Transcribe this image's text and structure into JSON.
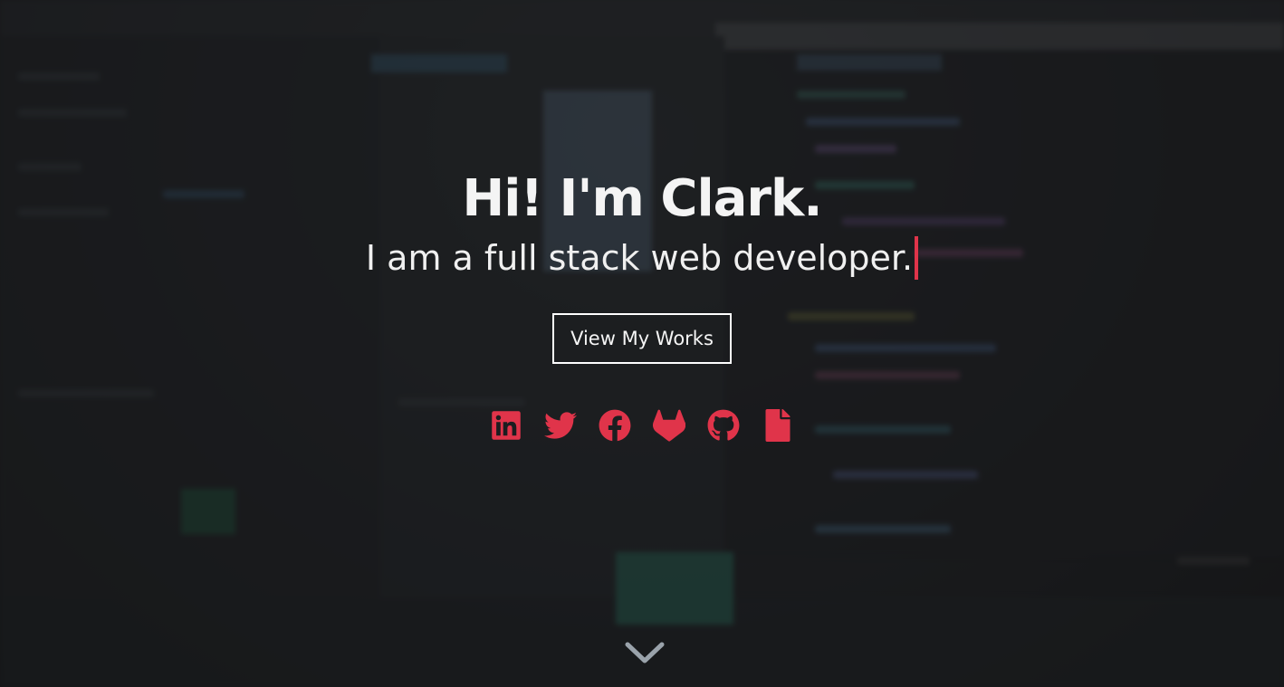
{
  "hero": {
    "title": "Hi! I'm Clark.",
    "subtitle": "I am a full stack web developer.",
    "cta_label": "View My Works"
  },
  "socials": [
    {
      "name": "linkedin",
      "icon": "linkedin-icon"
    },
    {
      "name": "twitter",
      "icon": "twitter-icon"
    },
    {
      "name": "facebook",
      "icon": "facebook-icon"
    },
    {
      "name": "gitlab",
      "icon": "gitlab-icon"
    },
    {
      "name": "github",
      "icon": "github-icon"
    },
    {
      "name": "resume",
      "icon": "file-icon"
    }
  ],
  "scroll_icon": "chevron-down-icon",
  "colors": {
    "accent": "#e0344a",
    "text": "#f4f4f4",
    "chevron": "#9aa3ab"
  }
}
